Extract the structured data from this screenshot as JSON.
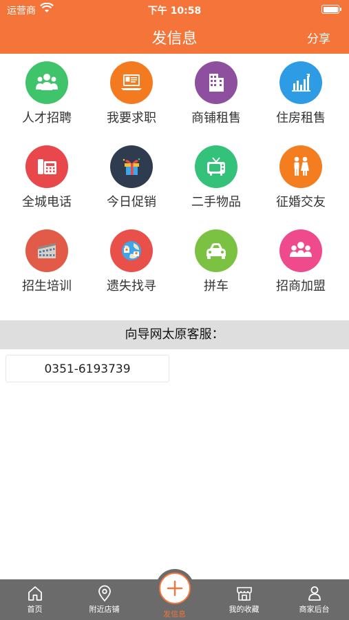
{
  "status_bar": {
    "carrier": "运营商",
    "time": "下午 10:58"
  },
  "nav": {
    "title": "发信息",
    "share": "分享"
  },
  "categories": [
    {
      "label": "人才招聘",
      "icon": "people-icon",
      "color": "#3fc36b"
    },
    {
      "label": "我要求职",
      "icon": "resume-icon",
      "color": "#f47a20"
    },
    {
      "label": "商铺租售",
      "icon": "building-icon",
      "color": "#8e4f9e"
    },
    {
      "label": "住房租售",
      "icon": "bar-chart-icon",
      "color": "#2d9ce5"
    },
    {
      "label": "全城电话",
      "icon": "telephone-icon",
      "color": "#e8474c"
    },
    {
      "label": "今日促销",
      "icon": "gift-icon",
      "color": "#2f3c50"
    },
    {
      "label": "二手物品",
      "icon": "tv-icon",
      "color": "#34c27a"
    },
    {
      "label": "征婚交友",
      "icon": "couple-icon",
      "color": "#f37d1f"
    },
    {
      "label": "招生培训",
      "icon": "school-icon",
      "color": "#e25a48"
    },
    {
      "label": "遗失找寻",
      "icon": "globe-people-icon",
      "color": "#e9504a"
    },
    {
      "label": "拼车",
      "icon": "car-icon",
      "color": "#7cc242"
    },
    {
      "label": "招商加盟",
      "icon": "group-icon",
      "color": "#ee4a8c"
    }
  ],
  "service": {
    "header": "向导网太原客服：",
    "phone": "0351-6193739"
  },
  "tabs": [
    {
      "label": "首页",
      "icon": "home-icon"
    },
    {
      "label": "附近店铺",
      "icon": "location-pin-icon"
    },
    {
      "label": "发信息",
      "icon": "plus-icon",
      "active": true
    },
    {
      "label": "我的收藏",
      "icon": "store-icon"
    },
    {
      "label": "商家后台",
      "icon": "user-icon"
    }
  ],
  "colors": {
    "accent": "#f4743a",
    "tab_bar": "#6b6b6b",
    "section_bg": "#dedede"
  }
}
